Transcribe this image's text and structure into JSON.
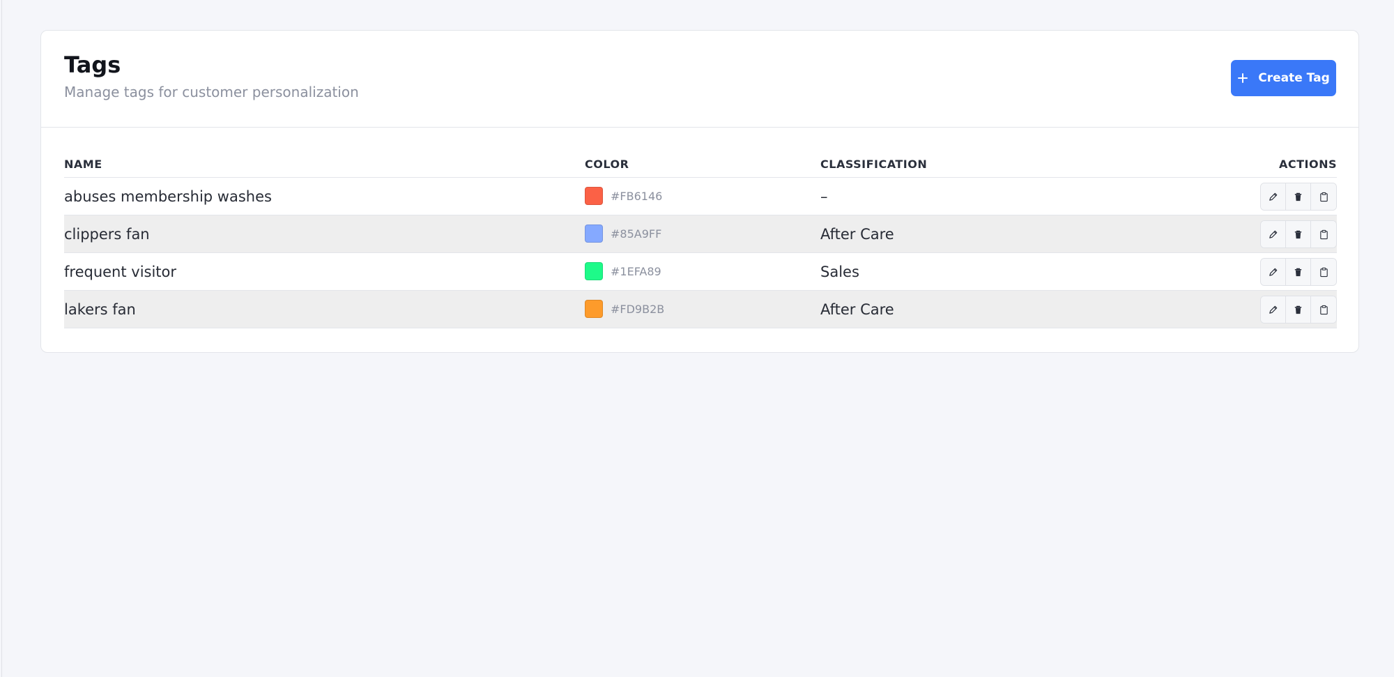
{
  "page": {
    "title": "Tags",
    "subtitle": "Manage tags for customer personalization",
    "create_button_label": "Create Tag"
  },
  "table": {
    "columns": {
      "name": "NAME",
      "color": "COLOR",
      "classification": "CLASSIFICATION",
      "actions": "ACTIONS"
    },
    "rows": [
      {
        "name": "abuses membership washes",
        "color": "#FB6146",
        "classification": "–"
      },
      {
        "name": "clippers fan",
        "color": "#85A9FF",
        "classification": "After Care"
      },
      {
        "name": "frequent visitor",
        "color": "#1EFA89",
        "classification": "Sales"
      },
      {
        "name": "lakers fan",
        "color": "#FD9B2B",
        "classification": "After Care"
      }
    ]
  },
  "icons": {
    "create": "plus-icon",
    "edit": "pencil-icon",
    "delete": "trash-icon",
    "copy": "clipboard-icon"
  },
  "colors": {
    "accent": "#3A78F8",
    "background": "#F5F6FA",
    "alt_row": "#EEEEEE"
  }
}
